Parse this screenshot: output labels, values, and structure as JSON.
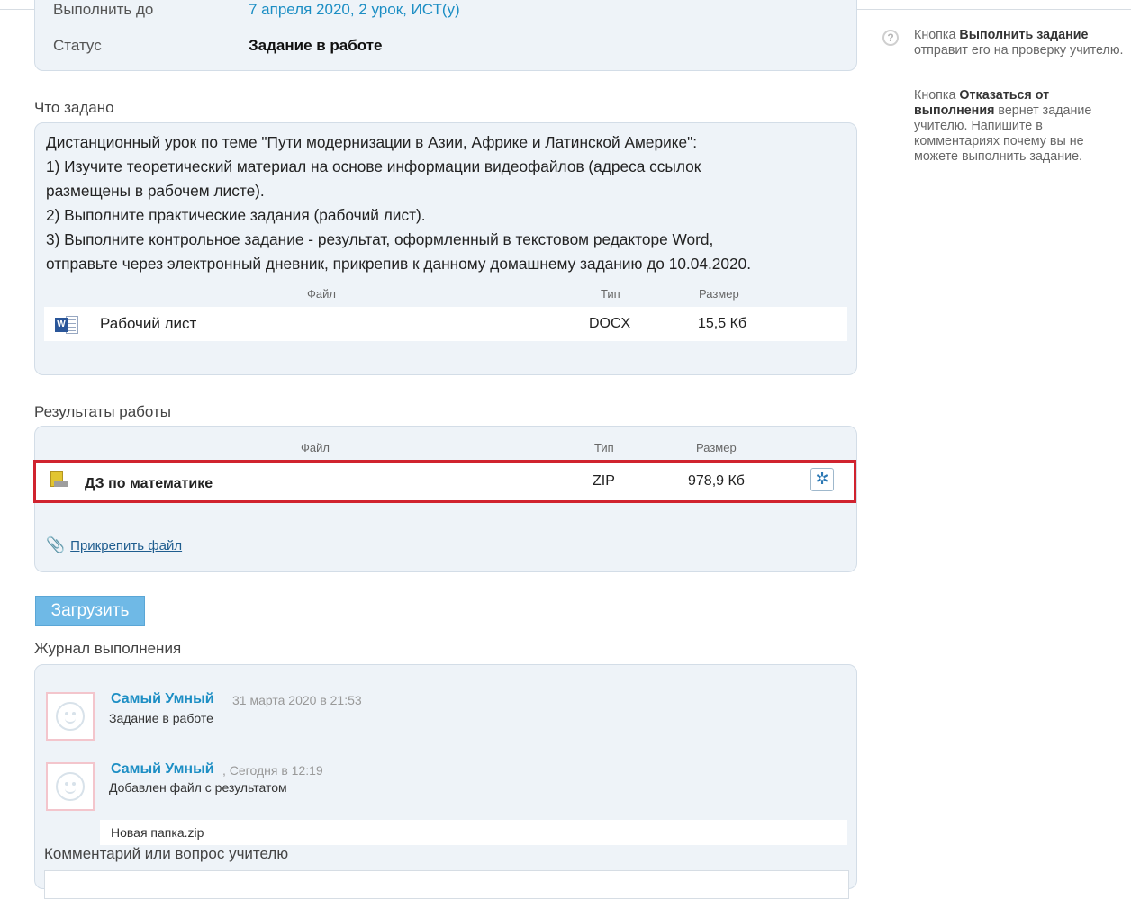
{
  "status": {
    "deadline_label": "Выполнить до",
    "deadline_value": "7 апреля 2020, 2 урок, ИСТ(у)",
    "status_label": "Статус",
    "status_value": "Задание в работе"
  },
  "task": {
    "title": "Что задано",
    "lines": [
      "Дистанционный урок по теме \"Пути модернизации в Азии, Африке и Латинской Америке\":",
      "1) Изучите теоретический материал на основе информации видеофайлов (адреса ссылок",
      "размещены в рабочем листе).",
      "2) Выполните практические задания (рабочий лист).",
      "3) Выполните контрольное задание - результат, оформленный в текстовом редакторе Word,",
      "отправьте через электронный дневник, прикрепив к данному домашнему заданию до 10.04.2020."
    ],
    "columns": {
      "file": "Файл",
      "type": "Тип",
      "size": "Размер"
    },
    "file": {
      "icon": "word-document-icon",
      "name": "Рабочий лист",
      "type": "DOCX",
      "size": "15,5 Кб"
    }
  },
  "results": {
    "title": "Результаты работы",
    "columns": {
      "file": "Файл",
      "type": "Тип",
      "size": "Размер"
    },
    "file": {
      "icon": "archive-icon",
      "name": "ДЗ по математике",
      "type": "ZIP",
      "size": "978,9 Кб"
    },
    "attach_label": "Прикрепить файл",
    "highlight_color": "#d0232f"
  },
  "upload_button": "Загрузить",
  "journal": {
    "title": "Журнал выполнения",
    "entries": [
      {
        "author": "Самый Умный",
        "date": "31 марта 2020 в 21:53",
        "text": "Задание в работе"
      },
      {
        "author": "Самый Умный",
        "date": ", Сегодня в 12:19",
        "text": "Добавлен файл с результатом"
      }
    ],
    "attached_file": "Новая папка.zip",
    "comment_label": "Комментарий или вопрос учителю"
  },
  "help": {
    "p1_prefix": "Кнопка ",
    "p1_bold": "Выполнить задание",
    "p1_suffix": " отправит его на проверку учителю.",
    "p2_prefix": "Кнопка ",
    "p2_bold": "Отказаться от выполнения",
    "p2_suffix": " вернет задание учителю. Напишите в комментариях почему вы не можете выполнить задание."
  },
  "colors": {
    "accent": "#1c8ec4",
    "button": "#6fb9e6",
    "panel": "#eef3f8"
  }
}
